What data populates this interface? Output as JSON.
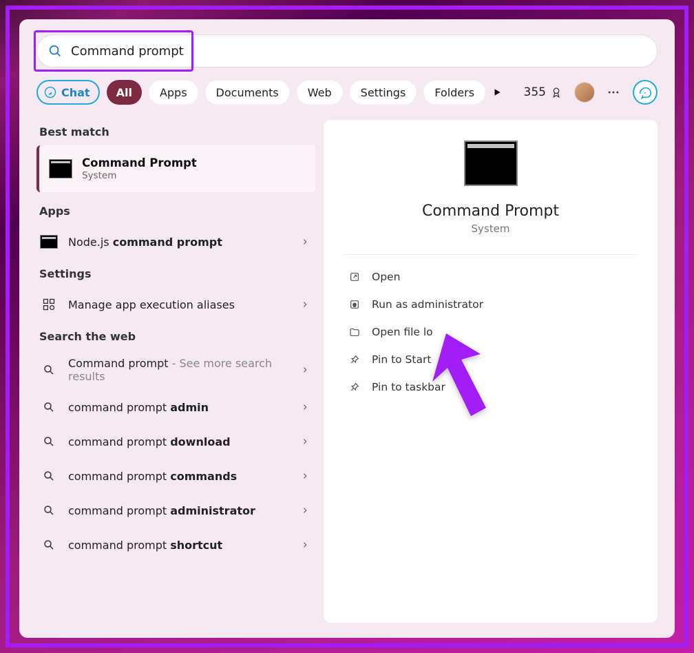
{
  "search": {
    "query": "Command prompt"
  },
  "filters": {
    "chat": "Chat",
    "all": "All",
    "apps": "Apps",
    "documents": "Documents",
    "web": "Web",
    "settings": "Settings",
    "folders": "Folders"
  },
  "header": {
    "points": "355"
  },
  "left": {
    "best_match_label": "Best match",
    "best_match": {
      "title": "Command Prompt",
      "subtitle": "System"
    },
    "apps_label": "Apps",
    "app_result": {
      "pre": "Node.js ",
      "bold": "command prompt"
    },
    "settings_label": "Settings",
    "setting_result": {
      "text": "Manage app execution aliases"
    },
    "web_label": "Search the web",
    "web_results": {
      "0": {
        "pre": "Command prompt",
        "thin": " - See more search results"
      },
      "1": {
        "pre": "command prompt ",
        "bold": "admin"
      },
      "2": {
        "pre": "command prompt ",
        "bold": "download"
      },
      "3": {
        "pre": "command prompt ",
        "bold": "commands"
      },
      "4": {
        "pre": "command prompt ",
        "bold": "administrator"
      },
      "5": {
        "pre": "command prompt ",
        "bold": "shortcut"
      }
    }
  },
  "right": {
    "title": "Command Prompt",
    "subtitle": "System",
    "actions": {
      "open": "Open",
      "run_admin": "Run as administrator",
      "open_loc": "Open file lo",
      "pin_start": "Pin to Start",
      "pin_taskbar": "Pin to taskbar"
    }
  }
}
